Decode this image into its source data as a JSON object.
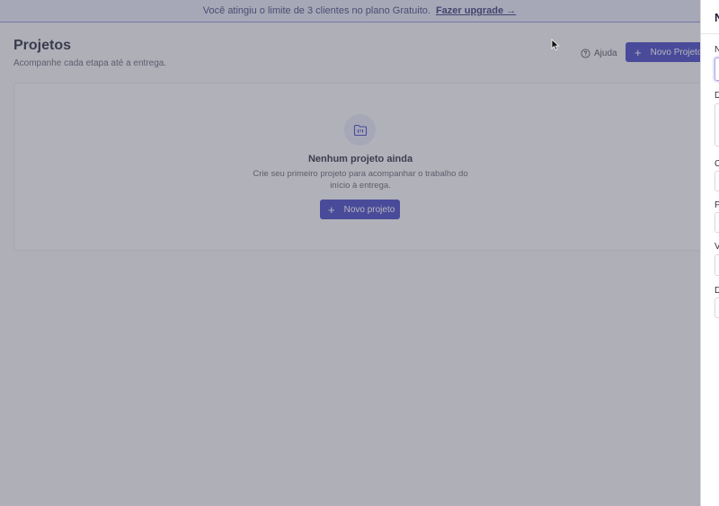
{
  "banner": {
    "message": "Você atingiu o limite de 3 clientes no plano Gratuito.",
    "upgrade_link": "Fazer upgrade →"
  },
  "header": {
    "title": "Projetos",
    "subtitle": "Acompanhe cada etapa até a entrega.",
    "help_label": "Ajuda",
    "new_project_label": "Novo Projeto"
  },
  "empty_state": {
    "title": "Nenhum projeto ainda",
    "description": "Crie seu primeiro projeto para acompanhar o trabalho do início à entrega.",
    "button_label": "Novo projeto",
    "icon": "folder-kanban-icon"
  },
  "drawer": {
    "title_fragment": "N",
    "field_label_fragments": [
      "N",
      "D",
      "C",
      "P",
      "V",
      "D"
    ]
  },
  "colors": {
    "primary": "#3b3ec4",
    "banner_bg": "#e6e8f7",
    "overlay": "rgba(90,92,104,0.45)"
  }
}
